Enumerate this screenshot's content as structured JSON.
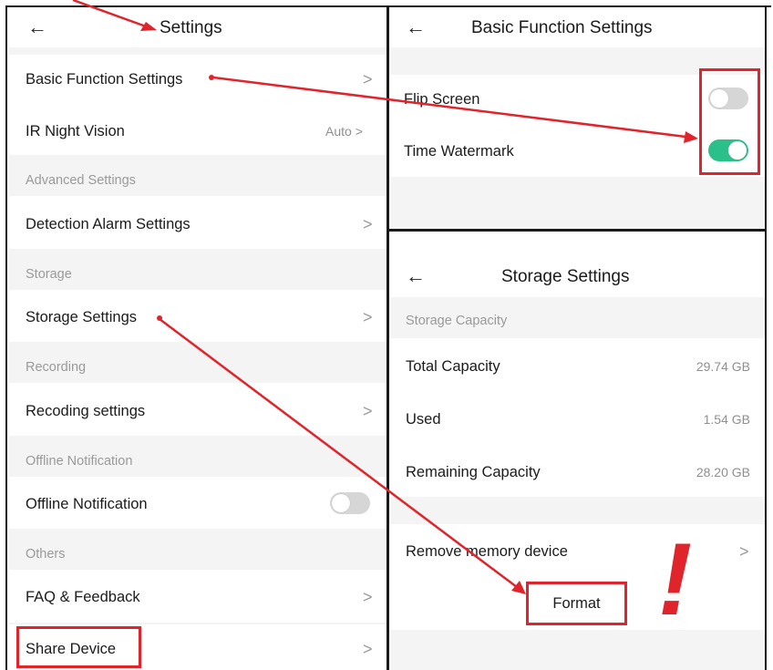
{
  "left": {
    "title": "Settings",
    "back_glyph": "←",
    "items": {
      "basic": {
        "label": "Basic Function Settings",
        "chevron": ">"
      },
      "ir": {
        "label": "IR Night Vision",
        "value": "Auto >"
      },
      "advanced_section": "Advanced Settings",
      "detection": {
        "label": "Detection Alarm Settings",
        "chevron": ">"
      },
      "storage_section": "Storage",
      "storage": {
        "label": "Storage Settings",
        "chevron": ">"
      },
      "recording_section": "Recording",
      "recording": {
        "label": "Recoding settings",
        "chevron": ">"
      },
      "offline_section": "Offline Notification",
      "offline": {
        "label": "Offline Notification",
        "toggle_on": false
      },
      "others_section": "Others",
      "faq": {
        "label": "FAQ & Feedback",
        "chevron": ">"
      },
      "share": {
        "label": "Share Device",
        "chevron": ">"
      }
    }
  },
  "basic_panel": {
    "title": "Basic Function Settings",
    "back_glyph": "←",
    "flip": {
      "label": "Flip Screen",
      "toggle_on": false
    },
    "watermark": {
      "label": "Time Watermark",
      "toggle_on": true
    }
  },
  "storage_panel": {
    "title": "Storage Settings",
    "back_glyph": "←",
    "section": "Storage Capacity",
    "total": {
      "label": "Total Capacity",
      "value": "29.74 GB"
    },
    "used": {
      "label": "Used",
      "value": "1.54 GB"
    },
    "remaining": {
      "label": "Remaining Capacity",
      "value": "28.20 GB"
    },
    "remove": {
      "label": "Remove memory device",
      "chevron": ">"
    },
    "format_label": "Format",
    "exclamation": "!"
  },
  "colors": {
    "annotation_red": "#e0242c",
    "toggle_on": "#2bbf8a",
    "toggle_off": "#d6d6d6",
    "band": "#f4f4f4",
    "border": "#1a1a1a"
  }
}
